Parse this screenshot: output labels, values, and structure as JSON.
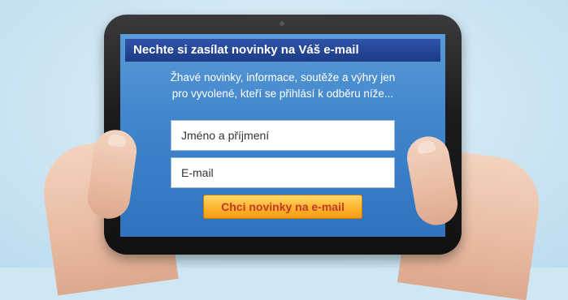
{
  "signup": {
    "title": "Nechte si zasílat novinky na Váš e-mail",
    "tagline_line1": "Žhavé novinky, informace, soutěže a výhry jen",
    "tagline_line2": "pro vyvolené, kteří se přihlásí k odběru níže...",
    "name_placeholder": "Jméno a příjmení",
    "email_placeholder": "E-mail",
    "submit_label": "Chci novinky na e-mail"
  },
  "colors": {
    "title_bar": "#1d3b86",
    "screen": "#3f85cc",
    "button": "#ffb733",
    "button_text": "#c0392b",
    "background": "#cfe6f3"
  }
}
